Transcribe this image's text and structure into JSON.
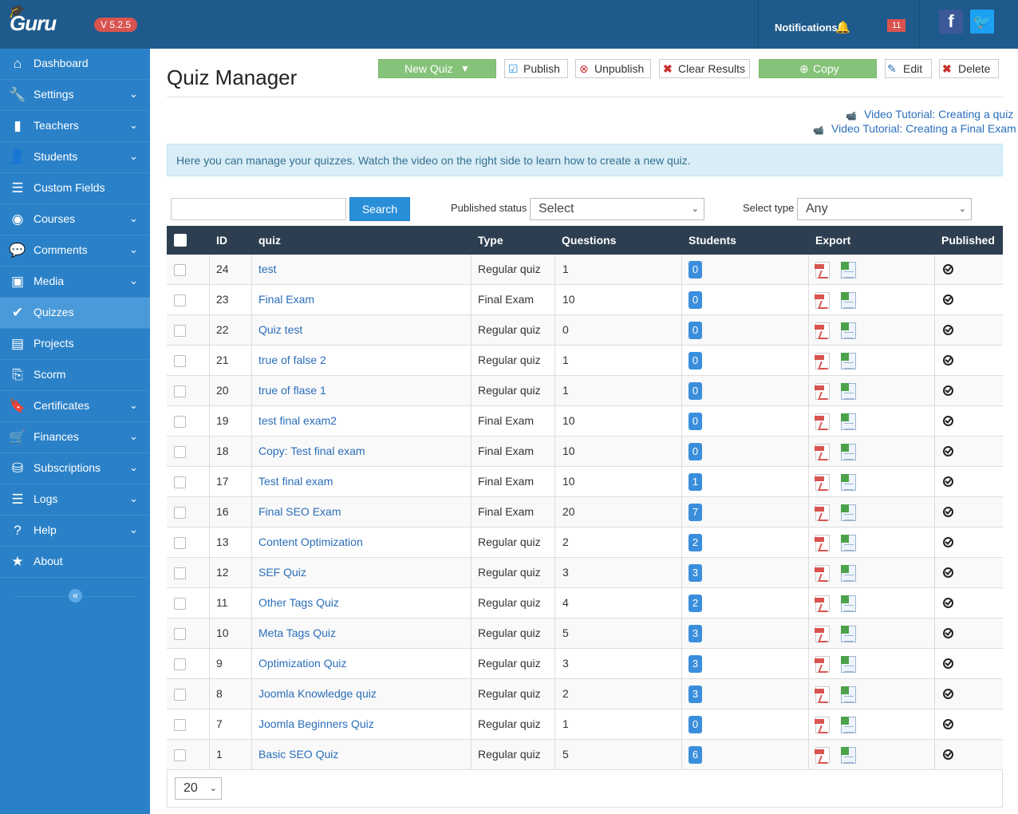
{
  "app": {
    "logo_text": "Guru",
    "version": "V 5.2.5",
    "notifications_label": "Notifications",
    "notifications_count": "11",
    "facebook_glyph": "f",
    "twitter_glyph": "🐦"
  },
  "sidebar": {
    "items": [
      {
        "label": "Dashboard",
        "icon": "home-icon",
        "glyph": "⌂",
        "chevron": false
      },
      {
        "label": "Settings",
        "icon": "wrench-icon",
        "glyph": "🔧",
        "chevron": true
      },
      {
        "label": "Teachers",
        "icon": "book-icon",
        "glyph": "▮",
        "chevron": true
      },
      {
        "label": "Students",
        "icon": "users-icon",
        "glyph": "👤",
        "chevron": true
      },
      {
        "label": "Custom Fields",
        "icon": "list-icon",
        "glyph": "☰",
        "chevron": false
      },
      {
        "label": "Courses",
        "icon": "eye-icon",
        "glyph": "◉",
        "chevron": true
      },
      {
        "label": "Comments",
        "icon": "comments-icon",
        "glyph": "💬",
        "chevron": true
      },
      {
        "label": "Media",
        "icon": "image-icon",
        "glyph": "▣",
        "chevron": true
      },
      {
        "label": "Quizzes",
        "icon": "check-circle-icon",
        "glyph": "✔",
        "chevron": false,
        "active": true
      },
      {
        "label": "Projects",
        "icon": "document-icon",
        "glyph": "▤",
        "chevron": false
      },
      {
        "label": "Scorm",
        "icon": "file-export-icon",
        "glyph": "⎘",
        "chevron": false
      },
      {
        "label": "Certificates",
        "icon": "bookmark-icon",
        "glyph": "🔖",
        "chevron": true
      },
      {
        "label": "Finances",
        "icon": "cart-icon",
        "glyph": "🛒",
        "chevron": true
      },
      {
        "label": "Subscriptions",
        "icon": "subscriptions-icon",
        "glyph": "⛁",
        "chevron": true
      },
      {
        "label": "Logs",
        "icon": "list-icon",
        "glyph": "☰",
        "chevron": true
      },
      {
        "label": "Help",
        "icon": "help-icon",
        "glyph": "?",
        "chevron": true
      },
      {
        "label": "About",
        "icon": "star-icon",
        "glyph": "★",
        "chevron": false
      }
    ],
    "collapse_glyph": "«"
  },
  "header": {
    "title": "Quiz Manager",
    "buttons": {
      "new_quiz": "New Quiz",
      "publish": "Publish",
      "unpublish": "Unpublish",
      "clear_results": "Clear Results",
      "copy": "Copy",
      "edit": "Edit",
      "delete": "Delete"
    },
    "video_links": [
      "Video Tutorial: Creating a quiz",
      "Video Tutorial: Creating a Final Exam"
    ],
    "info_text": "Here you can manage your quizzes. Watch the video on the right side to learn how to create a new quiz."
  },
  "filters": {
    "search_value": "",
    "search_button": "Search",
    "published_status_label": "Published status",
    "published_status_value": "Select",
    "select_type_label": "Select type",
    "select_type_value": "Any"
  },
  "table": {
    "columns": {
      "id": "ID",
      "quiz": "quiz",
      "type": "Type",
      "questions": "Questions",
      "students": "Students",
      "export": "Export",
      "published": "Published"
    },
    "rows": [
      {
        "id": "24",
        "quiz": "test",
        "type": "Regular quiz",
        "questions": "1",
        "students": "0"
      },
      {
        "id": "23",
        "quiz": "Final Exam",
        "type": "Final Exam",
        "questions": "10",
        "students": "0"
      },
      {
        "id": "22",
        "quiz": "Quiz test",
        "type": "Regular quiz",
        "questions": "0",
        "students": "0"
      },
      {
        "id": "21",
        "quiz": "true of false 2",
        "type": "Regular quiz",
        "questions": "1",
        "students": "0"
      },
      {
        "id": "20",
        "quiz": "true of flase 1",
        "type": "Regular quiz",
        "questions": "1",
        "students": "0"
      },
      {
        "id": "19",
        "quiz": "test final exam2",
        "type": "Final Exam",
        "questions": "10",
        "students": "0"
      },
      {
        "id": "18",
        "quiz": "Copy: Test final exam",
        "type": "Final Exam",
        "questions": "10",
        "students": "0"
      },
      {
        "id": "17",
        "quiz": "Test final exam",
        "type": "Final Exam",
        "questions": "10",
        "students": "1"
      },
      {
        "id": "16",
        "quiz": "Final SEO Exam",
        "type": "Final Exam",
        "questions": "20",
        "students": "7"
      },
      {
        "id": "13",
        "quiz": "Content Optimization",
        "type": "Regular quiz",
        "questions": "2",
        "students": "2"
      },
      {
        "id": "12",
        "quiz": "SEF Quiz",
        "type": "Regular quiz",
        "questions": "3",
        "students": "3"
      },
      {
        "id": "11",
        "quiz": "Other Tags Quiz",
        "type": "Regular quiz",
        "questions": "4",
        "students": "2"
      },
      {
        "id": "10",
        "quiz": "Meta Tags Quiz",
        "type": "Regular quiz",
        "questions": "5",
        "students": "3"
      },
      {
        "id": "9",
        "quiz": "Optimization Quiz",
        "type": "Regular quiz",
        "questions": "3",
        "students": "3"
      },
      {
        "id": "8",
        "quiz": "Joomla Knowledge quiz",
        "type": "Regular quiz",
        "questions": "2",
        "students": "3"
      },
      {
        "id": "7",
        "quiz": "Joomla Beginners Quiz",
        "type": "Regular quiz",
        "questions": "1",
        "students": "0"
      },
      {
        "id": "1",
        "quiz": "Basic SEO Quiz",
        "type": "Regular quiz",
        "questions": "5",
        "students": "6"
      }
    ]
  },
  "pagination": {
    "page_size": "20"
  }
}
